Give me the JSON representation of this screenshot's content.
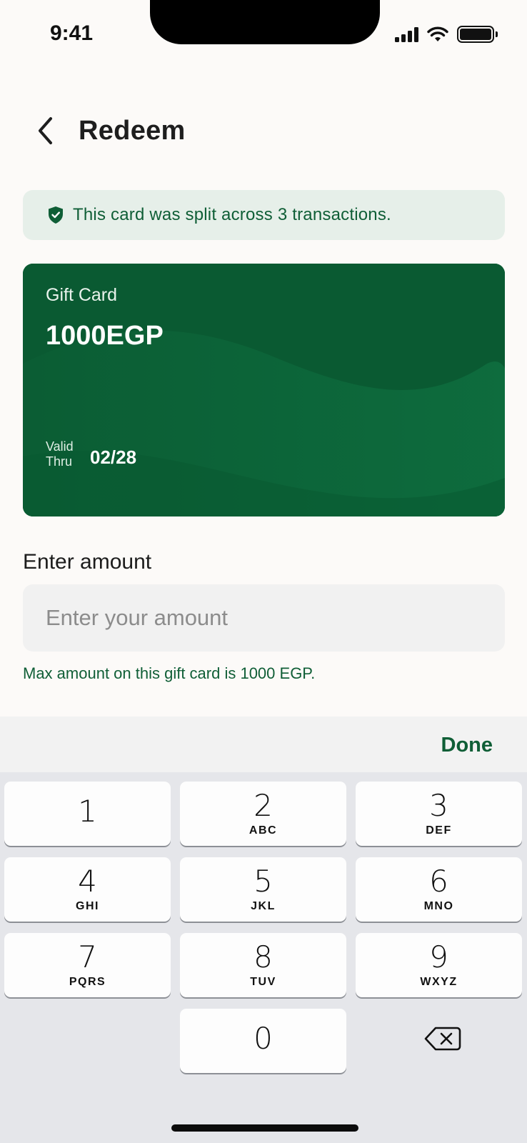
{
  "status_bar": {
    "time": "9:41"
  },
  "header": {
    "title": "Redeem"
  },
  "banner": {
    "text": "This card was split across 3 transactions."
  },
  "card": {
    "label": "Gift Card",
    "amount": "1000EGP",
    "valid_label": "Valid Thru",
    "valid_date": "02/28"
  },
  "amount": {
    "label": "Enter amount",
    "placeholder": "Enter your amount",
    "helper": "Max amount on this gift card is 1000 EGP."
  },
  "keyboard": {
    "done_label": "Done",
    "keys": [
      {
        "digit": "1",
        "letters": ""
      },
      {
        "digit": "2",
        "letters": "ABC"
      },
      {
        "digit": "3",
        "letters": "DEF"
      },
      {
        "digit": "4",
        "letters": "GHI"
      },
      {
        "digit": "5",
        "letters": "JKL"
      },
      {
        "digit": "6",
        "letters": "MNO"
      },
      {
        "digit": "7",
        "letters": "PQRS"
      },
      {
        "digit": "8",
        "letters": "TUV"
      },
      {
        "digit": "9",
        "letters": "WXYZ"
      },
      {
        "digit": "0",
        "letters": ""
      }
    ]
  },
  "colors": {
    "brand_green": "#0f5e36",
    "card_green": "#0a5a32",
    "banner_bg": "#e6efe9"
  },
  "icons": {
    "back": "chevron-left-icon",
    "shield": "shield-check-icon",
    "backspace": "backspace-icon"
  }
}
